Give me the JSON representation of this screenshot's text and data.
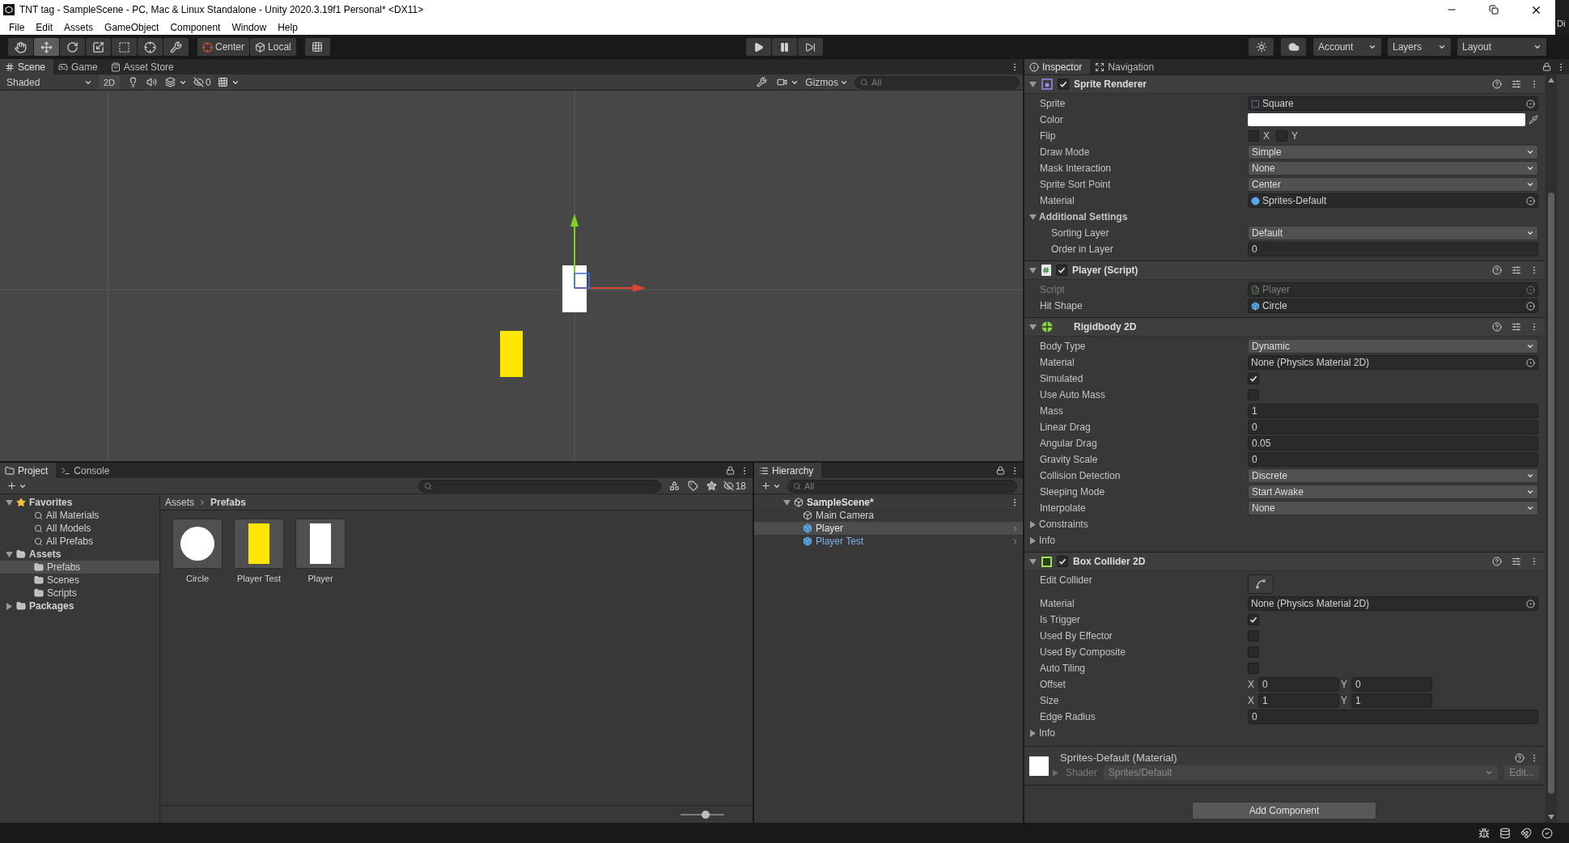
{
  "window": {
    "title": "TNT tag - SampleScene - PC, Mac & Linux Standalone - Unity 2020.3.19f1 Personal* <DX11>",
    "edge_text": "Di"
  },
  "menu": [
    "File",
    "Edit",
    "Assets",
    "GameObject",
    "Component",
    "Window",
    "Help"
  ],
  "toolbar": {
    "tools": [
      {
        "kind": "hand",
        "selected": false
      },
      {
        "kind": "move",
        "selected": true
      },
      {
        "kind": "rotate",
        "selected": false
      },
      {
        "kind": "scale",
        "selected": false
      },
      {
        "kind": "rect",
        "selected": false
      },
      {
        "kind": "transform",
        "selected": false
      },
      {
        "kind": "custom",
        "selected": false
      }
    ],
    "pivot": [
      "Center",
      "Local"
    ],
    "account": "Account",
    "layers": "Layers",
    "layout": "Layout"
  },
  "scene_panel": {
    "tabs": [
      {
        "label": "Scene",
        "kind": "scene",
        "selected": true
      },
      {
        "label": "Game",
        "kind": "game",
        "selected": false
      },
      {
        "label": "Asset Store",
        "kind": "store",
        "selected": false
      }
    ],
    "shading": "Shaded",
    "mode_2d": {
      "label": "2D",
      "selected": false
    },
    "hidden_count": "0",
    "gizmos": "Gizmos",
    "search_placeholder": "All",
    "objects": [
      {
        "kind": "rect",
        "color": "#ffffff",
        "selected": true
      },
      {
        "kind": "rect",
        "color": "#ffe600",
        "selected": false
      }
    ]
  },
  "project_panel": {
    "tabs": [
      {
        "label": "Project",
        "kind": "project",
        "selected": true
      },
      {
        "label": "Console",
        "kind": "console",
        "selected": false
      }
    ],
    "hidden_count": "18",
    "tree": [
      {
        "label": "Favorites",
        "kind": "favorites",
        "expanded": true,
        "selected": false,
        "children": [
          {
            "label": "All Materials",
            "kind": "search",
            "selected": false
          },
          {
            "label": "All Models",
            "kind": "search",
            "selected": false
          },
          {
            "label": "All Prefabs",
            "kind": "search",
            "selected": false
          }
        ]
      },
      {
        "label": "Assets",
        "kind": "folder",
        "expanded": true,
        "selected": false,
        "children": [
          {
            "label": "Prefabs",
            "kind": "folder",
            "selected": true
          },
          {
            "label": "Scenes",
            "kind": "folder",
            "selected": false
          },
          {
            "label": "Scripts",
            "kind": "folder",
            "selected": false
          }
        ]
      },
      {
        "label": "Packages",
        "kind": "folder",
        "expanded": false,
        "selected": false
      }
    ],
    "breadcrumb": [
      "Assets",
      "Prefabs"
    ],
    "assets": [
      {
        "name": "Circle",
        "kind": "circle",
        "color": "#ffffff"
      },
      {
        "name": "Player Test",
        "kind": "bar",
        "color": "#ffe600"
      },
      {
        "name": "Player",
        "kind": "bar",
        "color": "#ffffff"
      }
    ],
    "zoom_slider": {
      "level": 0.58
    }
  },
  "hierarchy_panel": {
    "tab": "Hierarchy",
    "search_placeholder": "All",
    "scene": {
      "label": "SampleScene*",
      "expanded": true,
      "children": [
        {
          "label": "Main Camera",
          "kind": "object",
          "selected": false
        },
        {
          "label": "Player",
          "kind": "prefab",
          "selected": true
        },
        {
          "label": "Player Test",
          "kind": "prefab",
          "selected": false
        }
      ]
    }
  },
  "inspector": {
    "tabs": [
      {
        "label": "Inspector",
        "kind": "info",
        "selected": true
      },
      {
        "label": "Navigation",
        "kind": "navigation",
        "selected": false
      }
    ],
    "components": [
      {
        "title": "Sprite Renderer",
        "kind": "sprite",
        "enabled": true,
        "expanded": true,
        "properties": [
          {
            "kind": "object",
            "label": "Sprite",
            "value": "Square",
            "disabled": false
          },
          {
            "kind": "color",
            "label": "Color",
            "color": "#ffffff"
          },
          {
            "kind": "flip",
            "label": "Flip",
            "toggles": [
              {
                "axis": "X",
                "checked": false
              },
              {
                "axis": "Y",
                "checked": false
              }
            ]
          },
          {
            "kind": "dropdown",
            "label": "Draw Mode",
            "value": "Simple"
          },
          {
            "kind": "dropdown",
            "label": "Mask Interaction",
            "value": "None"
          },
          {
            "kind": "dropdown",
            "label": "Sprite Sort Point",
            "value": "Center"
          },
          {
            "kind": "object",
            "label": "Material",
            "value": "Sprites-Default",
            "disabled": false
          },
          {
            "kind": "section",
            "label": "Additional Settings",
            "expanded": true,
            "children": [
              {
                "kind": "dropdown",
                "label": "Sorting Layer",
                "value": "Default"
              },
              {
                "kind": "number",
                "label": "Order in Layer",
                "value": "0"
              }
            ]
          }
        ]
      },
      {
        "title": "Player (Script)",
        "kind": "script",
        "enabled": true,
        "expanded": true,
        "properties": [
          {
            "kind": "object",
            "label": "Script",
            "value": "Player",
            "disabled": true
          },
          {
            "kind": "object",
            "label": "Hit Shape",
            "value": "Circle",
            "disabled": false
          }
        ]
      },
      {
        "title": "Rigidbody 2D",
        "kind": "rigidbody",
        "expanded": true,
        "properties": [
          {
            "kind": "dropdown",
            "label": "Body Type",
            "value": "Dynamic"
          },
          {
            "kind": "object",
            "label": "Material",
            "value": "None (Physics Material 2D)",
            "disabled": false
          },
          {
            "kind": "check",
            "label": "Simulated",
            "checked": true
          },
          {
            "kind": "check",
            "label": "Use Auto Mass",
            "checked": false
          },
          {
            "kind": "number",
            "label": "Mass",
            "value": "1"
          },
          {
            "kind": "number",
            "label": "Linear Drag",
            "value": "0"
          },
          {
            "kind": "number",
            "label": "Angular Drag",
            "value": "0.05"
          },
          {
            "kind": "number",
            "label": "Gravity Scale",
            "value": "0"
          },
          {
            "kind": "dropdown",
            "label": "Collision Detection",
            "value": "Discrete"
          },
          {
            "kind": "dropdown",
            "label": "Sleeping Mode",
            "value": "Start Awake"
          },
          {
            "kind": "dropdown",
            "label": "Interpolate",
            "value": "None"
          },
          {
            "kind": "section",
            "label": "Constraints",
            "expanded": false
          },
          {
            "kind": "section",
            "label": "Info",
            "expanded": false
          }
        ]
      },
      {
        "title": "Box Collider 2D",
        "kind": "collider",
        "enabled": true,
        "expanded": true,
        "properties": [
          {
            "kind": "edit_button",
            "label": "Edit Collider"
          },
          {
            "kind": "object",
            "label": "Material",
            "value": "None (Physics Material 2D)",
            "disabled": false
          },
          {
            "kind": "check",
            "label": "Is Trigger",
            "checked": true
          },
          {
            "kind": "check",
            "label": "Used By Effector",
            "checked": false
          },
          {
            "kind": "check",
            "label": "Used By Composite",
            "checked": false
          },
          {
            "kind": "check",
            "label": "Auto Tiling",
            "checked": false
          },
          {
            "kind": "vector",
            "label": "Offset",
            "fields": [
              {
                "axis": "X",
                "value": "0"
              },
              {
                "axis": "Y",
                "value": "0"
              }
            ]
          },
          {
            "kind": "vector",
            "label": "Size",
            "fields": [
              {
                "axis": "X",
                "value": "1"
              },
              {
                "axis": "Y",
                "value": "1"
              }
            ]
          },
          {
            "kind": "number",
            "label": "Edge Radius",
            "value": "0"
          },
          {
            "kind": "section",
            "label": "Info",
            "expanded": false
          }
        ]
      }
    ],
    "material": {
      "name": "Sprites-Default (Material)",
      "expanded": false,
      "shader_label": "Shader",
      "shader": "Sprites/Default",
      "edit": "Edit..."
    },
    "add_component": "Add Component"
  }
}
